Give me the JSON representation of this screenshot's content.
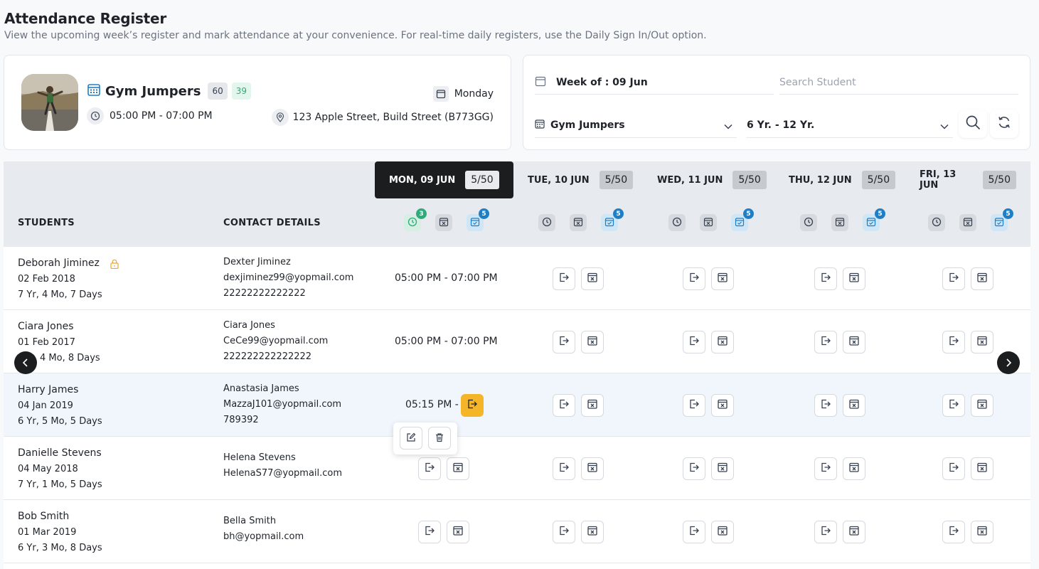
{
  "page": {
    "title": "Attendance Register",
    "subtitle": "View the upcoming week’s register and mark attendance at your convenience. For real-time daily registers, use the Daily Sign In/Out option."
  },
  "class_info": {
    "name": "Gym Jumpers",
    "count_total": "60",
    "count_present": "39",
    "time": "05:00 PM - 07:00 PM",
    "day": "Monday",
    "address": "123 Apple Street, Build Street (B773GG)"
  },
  "filters": {
    "week_label": "Week of : 09 Jun",
    "search_placeholder": "Search Student",
    "class_selected": "Gym Jumpers",
    "age_selected": "6 Yr. - 12 Yr."
  },
  "columns": {
    "students": "STUDENTS",
    "contact": "CONTACT DETAILS"
  },
  "days": [
    {
      "label": "MON, 09 JUN",
      "capacity": "5/50",
      "signed_in_count": "3",
      "booked_count": "5"
    },
    {
      "label": "TUE, 10 JUN",
      "capacity": "5/50",
      "booked_count": "5"
    },
    {
      "label": "WED, 11 JUN",
      "capacity": "5/50",
      "booked_count": "5"
    },
    {
      "label": "THU, 12 JUN",
      "capacity": "5/50",
      "booked_count": "5"
    },
    {
      "label": "FRI, 13 JUN",
      "capacity": "5/50",
      "booked_count": "5"
    }
  ],
  "students": [
    {
      "name": "Deborah Jiminez",
      "dob": "02 Feb 2018",
      "age": "7 Yr, 4 Mo, 7 Days",
      "contact_name": "Dexter Jiminez",
      "email": "dexjiminez99@yopmail.com",
      "phone": "22222222222222",
      "mon": "05:00 PM - 07:00 PM"
    },
    {
      "name": "Ciara Jones",
      "dob": "01 Feb 2017",
      "age": "4 Mo, 8 Days",
      "contact_name": "Ciara Jones",
      "email": "CeCe99@yopmail.com",
      "phone": "222222222222222",
      "mon": "05:00 PM - 07:00 PM"
    },
    {
      "name": "Harry James",
      "dob": "04 Jan 2019",
      "age": "6 Yr, 5 Mo, 5 Days",
      "contact_name": "Anastasia James",
      "email": "MazzaJ101@yopmail.com",
      "phone": "789392",
      "mon": "05:15 PM -"
    },
    {
      "name": "Danielle Stevens",
      "dob": "04 May 2018",
      "age": "7 Yr, 1 Mo, 5 Days",
      "contact_name": "Helena Stevens",
      "email": "HelenaS77@yopmail.com",
      "phone": ""
    },
    {
      "name": "Bob Smith",
      "dob": "01 Mar 2019",
      "age": "6 Yr, 3 Mo, 8 Days",
      "contact_name": "Bella Smith",
      "email": "bh@yopmail.com",
      "phone": ""
    }
  ],
  "colors": {
    "accent_dark": "#1c1d1f",
    "signin_active": "#f5b529",
    "green": "#2eab78",
    "blue": "#1e7fc6",
    "lock": "#f0a531"
  },
  "icons": [
    "calendar-icon",
    "clock-icon",
    "location-pin-icon",
    "search-icon",
    "refresh-icon",
    "chevron-down-icon",
    "sign-in-icon",
    "absent-icon",
    "edit-icon",
    "trash-icon",
    "lock-icon",
    "chevron-left-icon",
    "chevron-right-icon"
  ]
}
